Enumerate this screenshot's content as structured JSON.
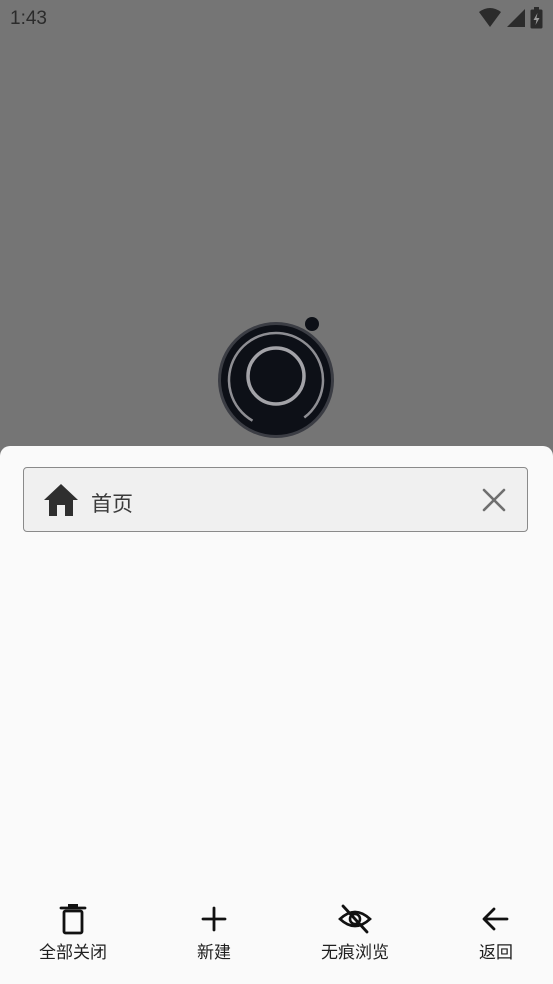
{
  "status_bar": {
    "time": "1:43",
    "icons": [
      "wifi-icon",
      "signal-icon",
      "battery-charging-icon"
    ]
  },
  "app_logo": "camera-lens-icon",
  "tabs": [
    {
      "title": "首页",
      "icon": "home-icon",
      "close_icon": "close-icon"
    }
  ],
  "actions": [
    {
      "label": "全部关闭",
      "icon": "trash-icon"
    },
    {
      "label": "新建",
      "icon": "plus-icon"
    },
    {
      "label": "无痕浏览",
      "icon": "eye-off-icon"
    },
    {
      "label": "返回",
      "icon": "arrow-back-icon"
    }
  ],
  "colors": {
    "scrim": "#757575",
    "sheet": "#fafafa",
    "tab_background": "#f0f0f0",
    "tab_border": "#8a8a8a",
    "icon": "#111111"
  }
}
